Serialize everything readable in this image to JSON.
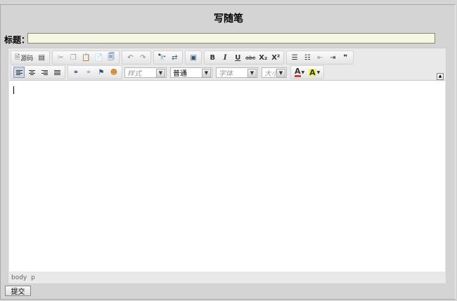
{
  "page": {
    "title": "写随笔"
  },
  "form": {
    "title_label": "标题：",
    "title_value": ""
  },
  "toolbar": {
    "source_label": "源码",
    "style_combo": {
      "placeholder": "样式"
    },
    "format_combo": {
      "value": "普通"
    },
    "font_combo": {
      "placeholder": "字体"
    },
    "size_combo": {
      "placeholder": "大小"
    },
    "bold_label": "B",
    "italic_label": "I",
    "underline_label": "U",
    "strike_label": "abc",
    "subscript_label": "X₂",
    "superscript_label": "X²",
    "blockquote_label": "❞",
    "text_color_label": "A",
    "bg_color_label": "A",
    "icons": [
      "new-page-icon",
      "template-icon",
      "cut-icon",
      "copy-icon",
      "paste-icon",
      "paste-text-icon",
      "paste-word-icon",
      "undo-icon",
      "redo-icon",
      "find-icon",
      "replace-icon",
      "select-all-icon",
      "bold-icon",
      "italic-icon",
      "underline-icon",
      "strike-icon",
      "subscript-icon",
      "superscript-icon",
      "ordered-list-icon",
      "bullet-list-icon",
      "outdent-icon",
      "indent-icon",
      "blockquote-icon",
      "align-left-icon",
      "align-center-icon",
      "align-right-icon",
      "align-justify-icon",
      "link-icon",
      "unlink-icon",
      "anchor-icon",
      "smiley-icon",
      "text-color-icon",
      "bg-color-icon"
    ]
  },
  "editor": {
    "content": "",
    "path": [
      "body",
      "p"
    ]
  },
  "submit": {
    "label": "提交"
  },
  "colors": {
    "page_bg": "#d4d4d4",
    "title_input_bg": "#f6f7e3",
    "editor_bg": "#e9e9e9",
    "text_color_swatch": "#d04040",
    "bg_color_swatch": "#f0f060"
  }
}
